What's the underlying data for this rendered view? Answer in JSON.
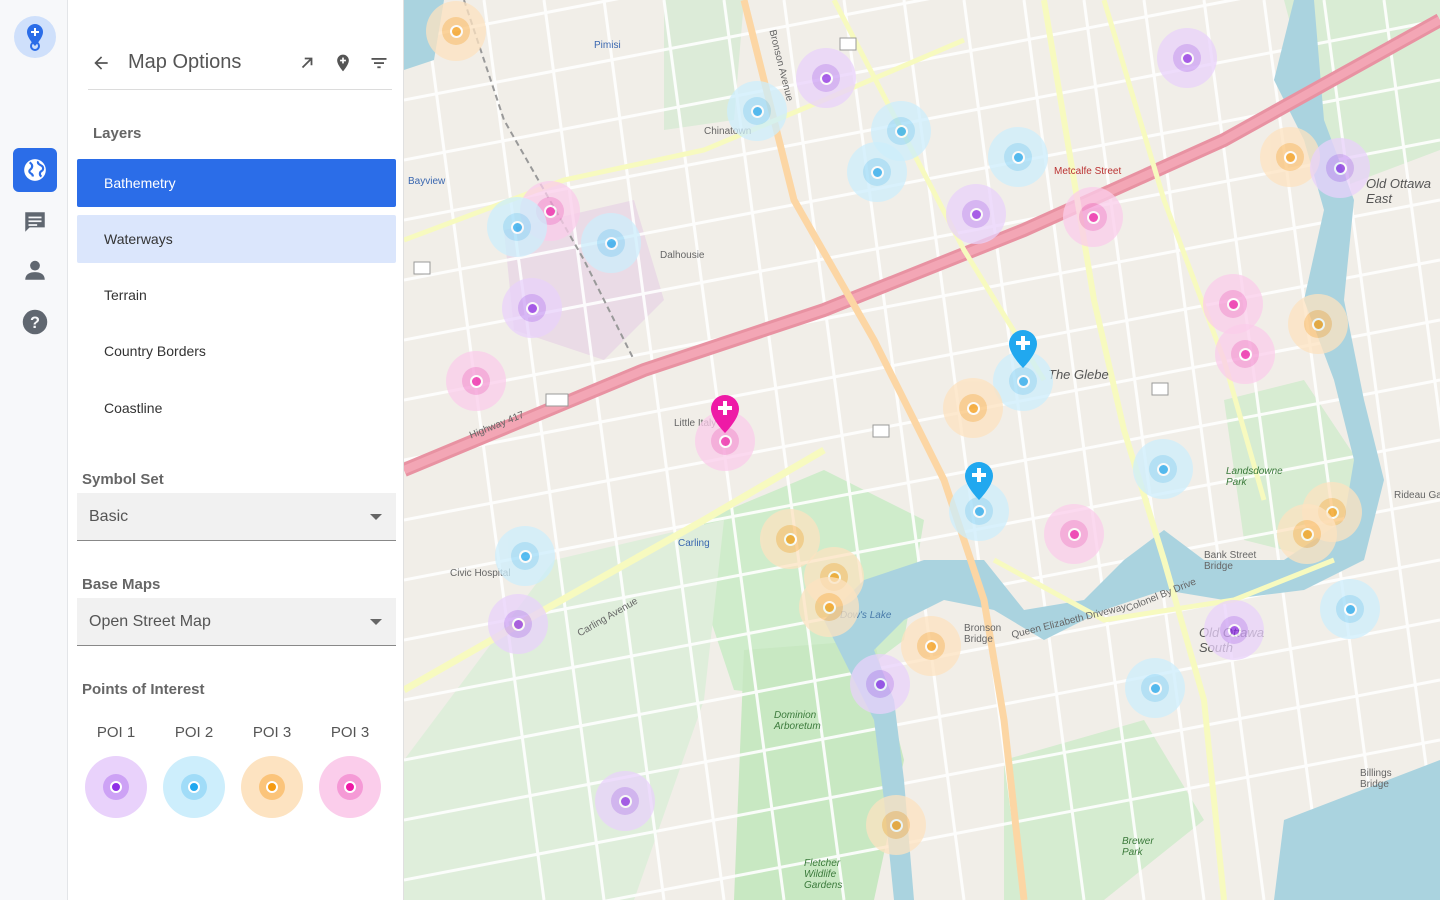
{
  "rail": {
    "items": [
      "globe-icon",
      "chat-icon",
      "person-icon",
      "help-icon"
    ],
    "active": "globe-icon"
  },
  "header": {
    "title": "Map Options"
  },
  "layers": {
    "heading": "Layers",
    "items": [
      {
        "label": "Bathemetry",
        "state": "selected"
      },
      {
        "label": "Waterways",
        "state": "hover"
      },
      {
        "label": "Terrain",
        "state": ""
      },
      {
        "label": "Country Borders",
        "state": ""
      },
      {
        "label": "Coastline",
        "state": ""
      }
    ]
  },
  "symbol_set": {
    "heading": "Symbol Set",
    "value": "Basic"
  },
  "base_maps": {
    "heading": "Base Maps",
    "value": "Open Street Map"
  },
  "poi": {
    "heading": "Points of Interest",
    "items": [
      {
        "label": "POI 1",
        "color": "#8f2fe6",
        "halo": "#e9d2fb",
        "mid": "#cda2f5"
      },
      {
        "label": "POI 2",
        "color": "#21a8ef",
        "halo": "#cdeefc",
        "mid": "#a0dcf8"
      },
      {
        "label": "POI 3",
        "color": "#f59b12",
        "halo": "#fde3c1",
        "mid": "#fbc47a"
      },
      {
        "label": "POI 3",
        "color": "#ee1aa6",
        "halo": "#fbcdeb",
        "mid": "#f59ad6"
      }
    ]
  },
  "map": {
    "labels": [
      {
        "text": "Chinatown"
      },
      {
        "text": "Dalhousie"
      },
      {
        "text": "The Glebe"
      },
      {
        "text": "Old Ottawa East"
      },
      {
        "text": "Old Ottawa South"
      },
      {
        "text": "Carling"
      },
      {
        "text": "Dow's Lake"
      },
      {
        "text": "Dominion Arboretum"
      },
      {
        "text": "Civic Hospital"
      },
      {
        "text": "Highway 417"
      },
      {
        "text": "Bronson Avenue"
      },
      {
        "text": "Bank Street Bridge"
      },
      {
        "text": "Bronson Bridge"
      },
      {
        "text": "Colonel By Drive"
      },
      {
        "text": "Queen Elizabeth Driveway"
      },
      {
        "text": "Carling Avenue"
      },
      {
        "text": "Bayview"
      },
      {
        "text": "Little Italy"
      },
      {
        "text": "Pimisi"
      },
      {
        "text": "Landsdowne Park"
      },
      {
        "text": "Brewer Park"
      },
      {
        "text": "Fletcher Wildlife Gardens"
      },
      {
        "text": "Billings Bridge"
      },
      {
        "text": "Rideau Garden"
      },
      {
        "text": "Metcalfe Street"
      }
    ]
  }
}
